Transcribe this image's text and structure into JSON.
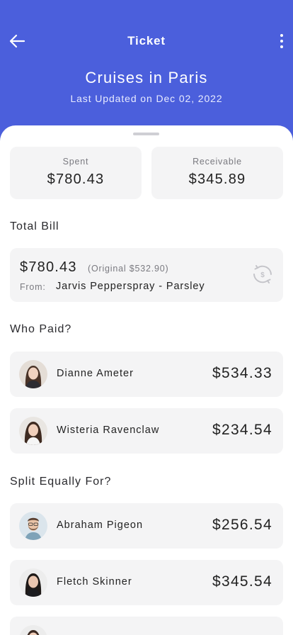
{
  "header": {
    "title": "Ticket",
    "event_title": "Cruises in Paris",
    "updated": "Last Updated on Dec 02, 2022"
  },
  "stats": {
    "spent_label": "Spent",
    "spent_value": "$780.43",
    "receivable_label": "Receivable",
    "receivable_value": "$345.89"
  },
  "total_bill": {
    "section_title": "Total Bill",
    "amount": "$780.43",
    "original": "(Original $532.90)",
    "from_label": "From:",
    "from_value": "Jarvis Pepperspray - Parsley"
  },
  "who_paid": {
    "section_title": "Who Paid?",
    "people": [
      {
        "name": "Dianne Ameter",
        "amount": "$534.33"
      },
      {
        "name": "Wisteria Ravenclaw",
        "amount": "$234.54"
      }
    ]
  },
  "split": {
    "section_title": "Split Equally For?",
    "people": [
      {
        "name": "Abraham Pigeon",
        "amount": "$256.54"
      },
      {
        "name": "Fletch Skinner",
        "amount": "$345.54"
      },
      {
        "name": "",
        "amount": ""
      }
    ]
  },
  "colors": {
    "header_bg": "#4b5fdc",
    "card_bg": "#f4f4f5",
    "text": "#2a2a2e"
  }
}
